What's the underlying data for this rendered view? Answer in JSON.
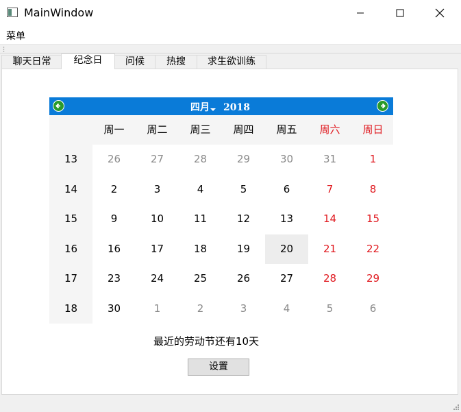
{
  "window": {
    "title": "MainWindow",
    "minimize_glyph": "—",
    "maximize_glyph": "☐",
    "close_glyph": "✕"
  },
  "menubar": {
    "items": [
      {
        "label": "菜单"
      }
    ]
  },
  "tabs": [
    {
      "label": "聊天日常",
      "active": false
    },
    {
      "label": "纪念日",
      "active": true
    },
    {
      "label": "问候",
      "active": false
    },
    {
      "label": "热搜",
      "active": false
    },
    {
      "label": "求生欲训练",
      "active": false
    }
  ],
  "calendar": {
    "month_label": "四月",
    "year_label": "2018",
    "nav_colors": {
      "bar": "#0a7bd8",
      "arrow": "#2a9a2a"
    },
    "weekday_headers": [
      "周一",
      "周二",
      "周三",
      "周四",
      "周五",
      "周六",
      "周日"
    ],
    "rows": [
      {
        "week": "13",
        "days": [
          "26",
          "27",
          "28",
          "29",
          "30",
          "31",
          "1"
        ],
        "outside": [
          true,
          true,
          true,
          true,
          true,
          true,
          false
        ]
      },
      {
        "week": "14",
        "days": [
          "2",
          "3",
          "4",
          "5",
          "6",
          "7",
          "8"
        ],
        "outside": [
          false,
          false,
          false,
          false,
          false,
          false,
          false
        ]
      },
      {
        "week": "15",
        "days": [
          "9",
          "10",
          "11",
          "12",
          "13",
          "14",
          "15"
        ],
        "outside": [
          false,
          false,
          false,
          false,
          false,
          false,
          false
        ]
      },
      {
        "week": "16",
        "days": [
          "16",
          "17",
          "18",
          "19",
          "20",
          "21",
          "22"
        ],
        "outside": [
          false,
          false,
          false,
          false,
          false,
          false,
          false
        ]
      },
      {
        "week": "17",
        "days": [
          "23",
          "24",
          "25",
          "26",
          "27",
          "28",
          "29"
        ],
        "outside": [
          false,
          false,
          false,
          false,
          false,
          false,
          false
        ]
      },
      {
        "week": "18",
        "days": [
          "30",
          "1",
          "2",
          "3",
          "4",
          "5",
          "6"
        ],
        "outside": [
          false,
          true,
          true,
          true,
          true,
          true,
          true
        ]
      }
    ],
    "selected_date": "20",
    "weekend_color": "#e0181e"
  },
  "message": "最近的劳动节还有10天",
  "settings_button": "设置"
}
